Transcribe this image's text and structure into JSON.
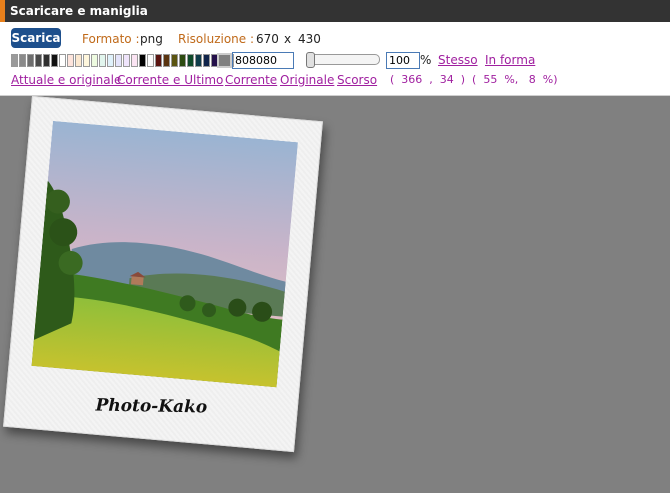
{
  "header": {
    "title": "Scaricare e maniglia"
  },
  "toolbar": {
    "download_label": "Scarica",
    "format_label": "Formato :",
    "format_value": "png",
    "resolution_label": "Risoluzione :",
    "width_value": "670",
    "times": "x",
    "height_value": "430",
    "color_value": "808080",
    "opacity_value": "100",
    "percent_sign": "%",
    "same_link": "Stesso",
    "fit_link": "In forma"
  },
  "swatches": [
    "#9a9a9a",
    "#8a8a8a",
    "#6e6e6e",
    "#4a4a4a",
    "#2f2f2f",
    "#111111",
    "#ffffff",
    "#fde4dc",
    "#fbe8d0",
    "#fff7dd",
    "#eefbe0",
    "#e2f6ee",
    "#e0f2fb",
    "#e4e4fb",
    "#efe4fb",
    "#fbe4f3",
    "#000000",
    "#fcfcfc",
    "#5a1410",
    "#5a3410",
    "#5a5410",
    "#2c4a10",
    "#104a2a",
    "#103c4a",
    "#10244a",
    "#24104a",
    "#3a104a",
    "#4a1030"
  ],
  "links": {
    "actual_original": "Attuale e originale",
    "current_last": "Corrente e Ultimo",
    "current": "Corrente",
    "original": "Originale",
    "scroll": "Scorso"
  },
  "coords_text": "(  366  ,  34  )  (  55  %,   8  %)",
  "canvas": {
    "background": "#808080"
  },
  "polaroid": {
    "caption": "Photo-Kako"
  }
}
